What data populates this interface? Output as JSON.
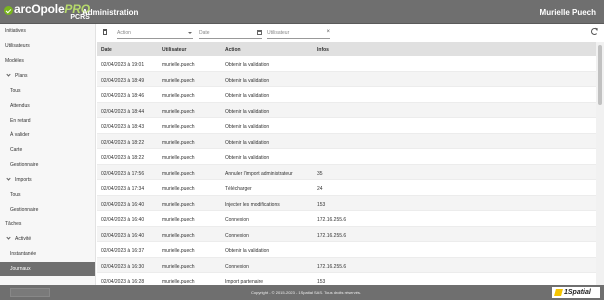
{
  "header": {
    "logo_main": "arcOpole",
    "logo_pro": "PRO",
    "logo_sub": "PCRS",
    "app_title": "Administration",
    "user_name": "Murielle Puech"
  },
  "sidebar": {
    "items": [
      {
        "label": "Initiatives"
      },
      {
        "label": "Utilisateurs"
      },
      {
        "label": "Modèles"
      },
      {
        "label": "Plans"
      },
      {
        "label": "Tous"
      },
      {
        "label": "Attendus"
      },
      {
        "label": "En retard"
      },
      {
        "label": "À valider"
      },
      {
        "label": "Carte"
      },
      {
        "label": "Gestionnaire"
      },
      {
        "label": "Imports"
      },
      {
        "label": "Tous"
      },
      {
        "label": "Gestionnaire"
      },
      {
        "label": "Tâches"
      },
      {
        "label": "Activité"
      },
      {
        "label": "Instantanée"
      },
      {
        "label": "Journaux"
      }
    ]
  },
  "filters": {
    "action_placeholder": "Action",
    "date_placeholder": "Date",
    "user_placeholder": "Utilisateur"
  },
  "table": {
    "headers": [
      "Date",
      "Utilisateur",
      "Action",
      "Infos"
    ],
    "rows": [
      [
        "02/04/2023 à 19:01",
        "murielle.puech",
        "Obtenir la validation",
        ""
      ],
      [
        "02/04/2023 à 18:49",
        "murielle.puech",
        "Obtenir la validation",
        ""
      ],
      [
        "02/04/2023 à 18:46",
        "murielle.puech",
        "Obtenir la validation",
        ""
      ],
      [
        "02/04/2023 à 18:44",
        "murielle.puech",
        "Obtenir la validation",
        ""
      ],
      [
        "02/04/2023 à 18:43",
        "murielle.puech",
        "Obtenir la validation",
        ""
      ],
      [
        "02/04/2023 à 18:22",
        "murielle.puech",
        "Obtenir la validation",
        ""
      ],
      [
        "02/04/2023 à 18:22",
        "murielle.puech",
        "Obtenir la validation",
        ""
      ],
      [
        "02/04/2023 à 17:56",
        "murielle.puech",
        "Annuler l'import administrateur",
        "35"
      ],
      [
        "02/04/2023 à 17:34",
        "murielle.puech",
        "Télécharger",
        "24"
      ],
      [
        "02/04/2023 à 16:40",
        "murielle.puech",
        "Injecter les modifications",
        "153"
      ],
      [
        "02/04/2023 à 16:40",
        "murielle.puech",
        "Connexion",
        "172.16.255.6"
      ],
      [
        "02/04/2023 à 16:40",
        "murielle.puech",
        "Connexion",
        "172.16.255.6"
      ],
      [
        "02/04/2023 à 16:37",
        "murielle.puech",
        "Obtenir la validation",
        ""
      ],
      [
        "02/04/2023 à 16:30",
        "murielle.puech",
        "Connexion",
        "172.16.255.6"
      ],
      [
        "02/04/2023 à 16:28",
        "murielle.puech",
        "Import partenaire",
        "153"
      ]
    ]
  },
  "footer": {
    "copyright": "Copyright - © 2015-2023 - 1Spatial SAS. Tous droits réservés.",
    "brand": "1Spatial"
  },
  "colors": {
    "topbar": "#6f6f6f",
    "accent_green": "#7ab51d",
    "brand_yellow": "#f5c400"
  }
}
